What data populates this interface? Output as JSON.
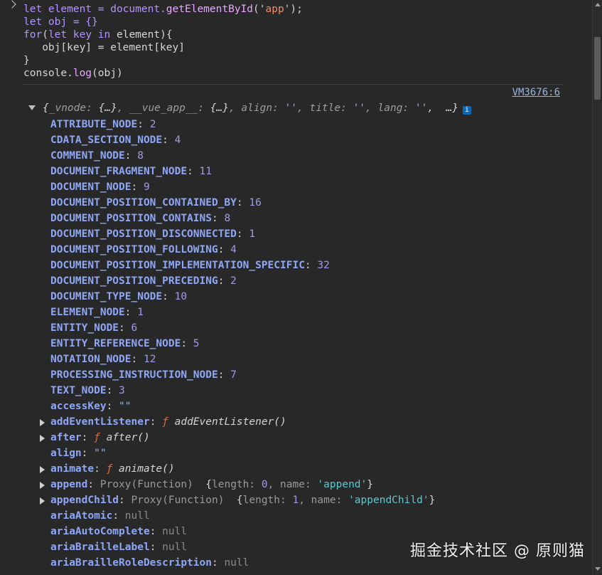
{
  "code_lines": [
    {
      "parts": [
        {
          "t": "let ",
          "c": "kw"
        },
        {
          "t": "element = document.",
          "c": "kw"
        },
        {
          "t": "getElementById",
          "c": "fn"
        },
        {
          "t": "('",
          "c": "plain"
        },
        {
          "t": "app",
          "c": "str"
        },
        {
          "t": "');",
          "c": "plain"
        }
      ]
    },
    {
      "parts": [
        {
          "t": "let ",
          "c": "kw"
        },
        {
          "t": "obj = {}",
          "c": "kw"
        }
      ]
    },
    {
      "parts": [
        {
          "t": "for",
          "c": "kw"
        },
        {
          "t": "(",
          "c": "plain"
        },
        {
          "t": "let ",
          "c": "kw"
        },
        {
          "t": "key ",
          "c": "kw"
        },
        {
          "t": "in ",
          "c": "kw"
        },
        {
          "t": "element){",
          "c": "plain"
        }
      ]
    },
    {
      "parts": [
        {
          "t": "   obj[key] = element[key]",
          "c": "plain"
        }
      ]
    },
    {
      "parts": [
        {
          "t": "}",
          "c": "plain"
        }
      ]
    },
    {
      "parts": [
        {
          "t": "console.",
          "c": "plain"
        },
        {
          "t": "log",
          "c": "fn"
        },
        {
          "t": "(obj)",
          "c": "plain"
        }
      ]
    }
  ],
  "source_link": "VM3676:6",
  "summary": {
    "parts": [
      {
        "t": "{",
        "c": "sum-val"
      },
      {
        "t": "_vnode: ",
        "c": "sum-key"
      },
      {
        "t": "{…}",
        "c": "sum-val"
      },
      {
        "t": ", ",
        "c": "sum-key"
      },
      {
        "t": "__vue_app__: ",
        "c": "sum-key"
      },
      {
        "t": "{…}",
        "c": "sum-val"
      },
      {
        "t": ", ",
        "c": "sum-key"
      },
      {
        "t": "align: ",
        "c": "sum-key"
      },
      {
        "t": "''",
        "c": "sum-str"
      },
      {
        "t": ", ",
        "c": "sum-key"
      },
      {
        "t": "title: ",
        "c": "sum-key"
      },
      {
        "t": "''",
        "c": "sum-str"
      },
      {
        "t": ", ",
        "c": "sum-key"
      },
      {
        "t": "lang: ",
        "c": "sum-key"
      },
      {
        "t": "''",
        "c": "sum-str"
      },
      {
        "t": ",  …}",
        "c": "sum-val"
      }
    ],
    "badge": "i"
  },
  "properties": [
    {
      "key": "ATTRIBUTE_NODE",
      "value": "2",
      "type": "num"
    },
    {
      "key": "CDATA_SECTION_NODE",
      "value": "4",
      "type": "num"
    },
    {
      "key": "COMMENT_NODE",
      "value": "8",
      "type": "num"
    },
    {
      "key": "DOCUMENT_FRAGMENT_NODE",
      "value": "11",
      "type": "num"
    },
    {
      "key": "DOCUMENT_NODE",
      "value": "9",
      "type": "num"
    },
    {
      "key": "DOCUMENT_POSITION_CONTAINED_BY",
      "value": "16",
      "type": "num"
    },
    {
      "key": "DOCUMENT_POSITION_CONTAINS",
      "value": "8",
      "type": "num"
    },
    {
      "key": "DOCUMENT_POSITION_DISCONNECTED",
      "value": "1",
      "type": "num"
    },
    {
      "key": "DOCUMENT_POSITION_FOLLOWING",
      "value": "4",
      "type": "num"
    },
    {
      "key": "DOCUMENT_POSITION_IMPLEMENTATION_SPECIFIC",
      "value": "32",
      "type": "num"
    },
    {
      "key": "DOCUMENT_POSITION_PRECEDING",
      "value": "2",
      "type": "num"
    },
    {
      "key": "DOCUMENT_TYPE_NODE",
      "value": "10",
      "type": "num"
    },
    {
      "key": "ELEMENT_NODE",
      "value": "1",
      "type": "num"
    },
    {
      "key": "ENTITY_NODE",
      "value": "6",
      "type": "num"
    },
    {
      "key": "ENTITY_REFERENCE_NODE",
      "value": "5",
      "type": "num"
    },
    {
      "key": "NOTATION_NODE",
      "value": "12",
      "type": "num"
    },
    {
      "key": "PROCESSING_INSTRUCTION_NODE",
      "value": "7",
      "type": "num"
    },
    {
      "key": "TEXT_NODE",
      "value": "3",
      "type": "num"
    },
    {
      "key": "accessKey",
      "value": "\"\"",
      "type": "s"
    },
    {
      "key": "addEventListener",
      "value": "addEventListener()",
      "type": "func",
      "expandable": true
    },
    {
      "key": "after",
      "value": "after()",
      "type": "func",
      "expandable": true
    },
    {
      "key": "align",
      "value": "\"\"",
      "type": "s"
    },
    {
      "key": "animate",
      "value": "animate()",
      "type": "func",
      "expandable": true
    },
    {
      "key": "append",
      "value": "Proxy(Function)",
      "type": "proxy",
      "detail_name": "append",
      "detail_length": "0",
      "expandable": true
    },
    {
      "key": "appendChild",
      "value": "Proxy(Function)",
      "type": "proxy",
      "detail_name": "appendChild",
      "detail_length": "1",
      "expandable": true
    },
    {
      "key": "ariaAtomic",
      "value": "null",
      "type": "nul"
    },
    {
      "key": "ariaAutoComplete",
      "value": "null",
      "type": "nul"
    },
    {
      "key": "ariaBrailleLabel",
      "value": "null",
      "type": "nul"
    },
    {
      "key": "ariaBrailleRoleDescription",
      "value": "null",
      "type": "nul"
    }
  ],
  "watermark": "掘金技术社区 @ 原则猫"
}
